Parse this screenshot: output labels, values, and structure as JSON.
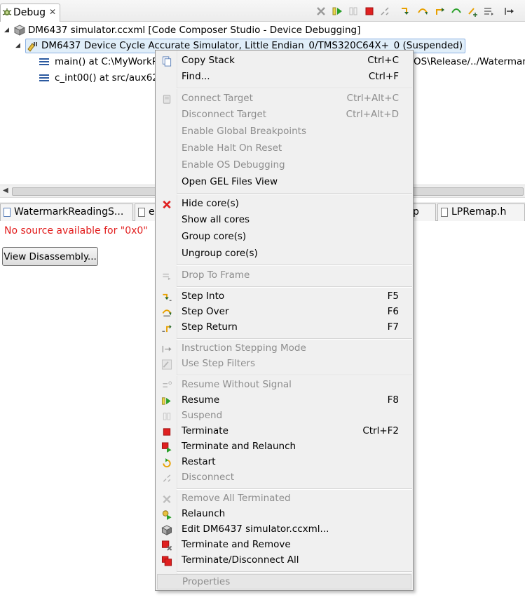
{
  "debug_view": {
    "tab_label": "Debug",
    "tree": [
      {
        "label": "DM6437 simulator.ccxml [Code Composer Studio - Device Debugging]"
      },
      {
        "label": "DM6437 Device Cycle Accurate Simulator, Little Endian_0/TMS320C64X+_0 (Suspended)"
      },
      {
        "label_left": "main() at C:\\MyWorkR",
        "label_right": "OS\\Release/../Watermar"
      },
      {
        "label": "c_int00() at src/aux62/"
      }
    ]
  },
  "editor": {
    "tabs": [
      {
        "label": "WatermarkReadingS..."
      },
      {
        "label": "e"
      },
      {
        "label": "p"
      },
      {
        "label": "LPRemap.h"
      }
    ],
    "message": "No source available for \"0x0\"",
    "button_label": "View Disassembly..."
  },
  "context_menu": {
    "copy_stack": {
      "label": "Copy Stack",
      "shortcut": "Ctrl+C"
    },
    "find": {
      "label": "Find...",
      "shortcut": "Ctrl+F"
    },
    "connect_target": {
      "label": "Connect Target",
      "shortcut": "Ctrl+Alt+C"
    },
    "disconnect_target": {
      "label": "Disconnect Target",
      "shortcut": "Ctrl+Alt+D"
    },
    "enable_global_breakpoints": {
      "label": "Enable Global Breakpoints"
    },
    "enable_halt_on_reset": {
      "label": "Enable Halt On Reset"
    },
    "enable_os_debugging": {
      "label": "Enable OS Debugging"
    },
    "open_gel_files_view": {
      "label": "Open GEL Files View"
    },
    "hide_cores": {
      "label": "Hide core(s)"
    },
    "show_all_cores": {
      "label": "Show all cores"
    },
    "group_cores": {
      "label": "Group core(s)"
    },
    "ungroup_cores": {
      "label": "Ungroup core(s)"
    },
    "drop_to_frame": {
      "label": "Drop To Frame"
    },
    "step_into": {
      "label": "Step Into",
      "shortcut": "F5"
    },
    "step_over": {
      "label": "Step Over",
      "shortcut": "F6"
    },
    "step_return": {
      "label": "Step Return",
      "shortcut": "F7"
    },
    "instruction_stepping_mode": {
      "label": "Instruction Stepping Mode"
    },
    "use_step_filters": {
      "label": "Use Step Filters"
    },
    "resume_without_signal": {
      "label": "Resume Without Signal"
    },
    "resume": {
      "label": "Resume",
      "shortcut": "F8"
    },
    "suspend": {
      "label": "Suspend"
    },
    "terminate": {
      "label": "Terminate",
      "shortcut": "Ctrl+F2"
    },
    "terminate_and_relaunch": {
      "label": "Terminate and Relaunch"
    },
    "restart": {
      "label": "Restart"
    },
    "disconnect": {
      "label": "Disconnect"
    },
    "remove_all_terminated": {
      "label": "Remove All Terminated"
    },
    "relaunch": {
      "label": "Relaunch"
    },
    "edit_config": {
      "label": "Edit DM6437 simulator.ccxml..."
    },
    "terminate_and_remove": {
      "label": "Terminate and Remove"
    },
    "terminate_disconnect_all": {
      "label": "Terminate/Disconnect All"
    },
    "properties": {
      "label": "Properties"
    }
  },
  "colors": {
    "selection_fill": "#e0eef9",
    "selection_border": "#8db2e3",
    "error_text": "#e21c1c",
    "disabled_text": "#8d8d8d",
    "terminate_red": "#e02020",
    "resume_green": "#2aa02a",
    "step_orange": "#e8a000"
  }
}
